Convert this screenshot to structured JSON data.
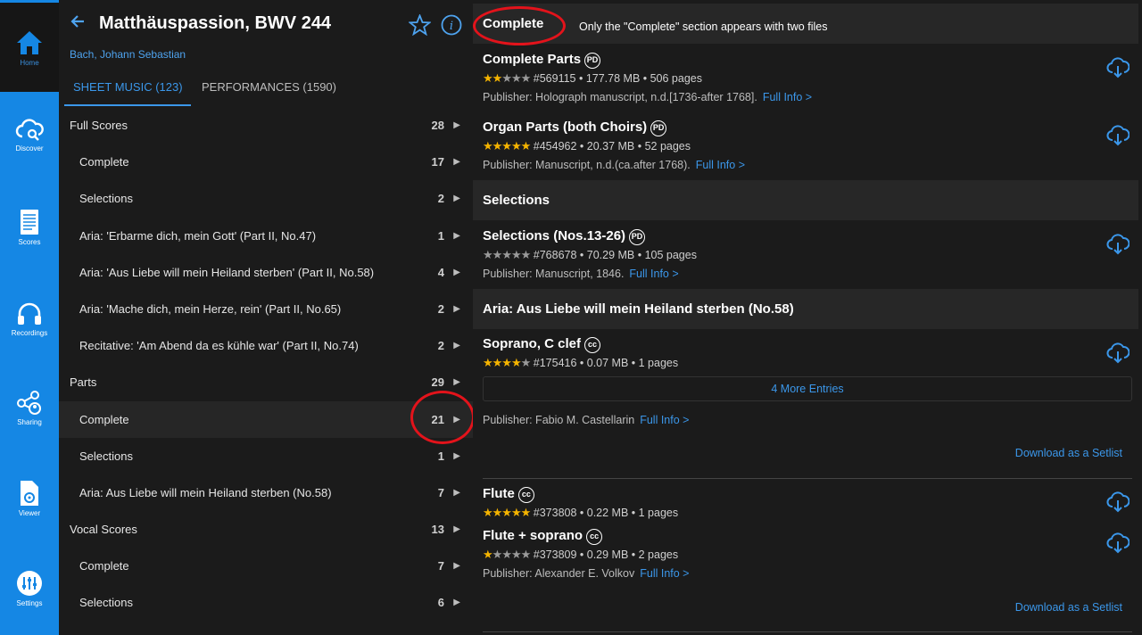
{
  "rail": [
    {
      "label": "Home",
      "icon": "home-icon"
    },
    {
      "label": "Discover",
      "icon": "cloud-search-icon"
    },
    {
      "label": "Scores",
      "icon": "scores-icon"
    },
    {
      "label": "Recordings",
      "icon": "headphones-icon"
    },
    {
      "label": "Sharing",
      "icon": "share-icon"
    },
    {
      "label": "Viewer",
      "icon": "pdf-viewer-icon"
    },
    {
      "label": "Settings",
      "icon": "settings-sliders-icon"
    }
  ],
  "header": {
    "title": "Matthäuspassion, BWV 244",
    "composer": "Bach, Johann Sebastian"
  },
  "tabs": {
    "sheet": "SHEET MUSIC (123)",
    "perf": "PERFORMANCES (1590)"
  },
  "list": [
    {
      "label": "Full Scores",
      "count": "28"
    },
    {
      "label": "Complete",
      "count": "17"
    },
    {
      "label": "Selections",
      "count": "2"
    },
    {
      "label": "Aria: 'Erbarme dich, mein Gott' (Part II, No.47)",
      "count": "1"
    },
    {
      "label": "Aria: 'Aus Liebe will mein Heiland sterben' (Part II, No.58)",
      "count": "4"
    },
    {
      "label": "Aria: 'Mache dich, mein Herze, rein' (Part II, No.65)",
      "count": "2"
    },
    {
      "label": "Recitative: 'Am Abend da es kühle war' (Part II, No.74)",
      "count": "2"
    },
    {
      "label": "Parts",
      "count": "29"
    },
    {
      "label": "Complete",
      "count": "21"
    },
    {
      "label": "Selections",
      "count": "1"
    },
    {
      "label": "Aria: Aus Liebe will mein Heiland sterben (No.58)",
      "count": "7"
    },
    {
      "label": "Vocal Scores",
      "count": "13"
    },
    {
      "label": "Complete",
      "count": "7"
    },
    {
      "label": "Selections",
      "count": "6"
    }
  ],
  "right": {
    "complete_head": "Complete",
    "annotation": "Only the \"Complete\" section appears with two files",
    "selections_head": "Selections",
    "aria_head": "Aria: Aus Liebe will mein Heiland sterben (No.58)",
    "full_info": "Full Info >",
    "more_entries": "4 More Entries",
    "setlist": "Download as a Setlist",
    "files": [
      {
        "name": "Complete Parts",
        "license": "PD",
        "rating": 2,
        "meta": "#569115 • 177.78 MB • 506 pages",
        "publisher": "Publisher: Holograph manuscript, n.d.[1736-after 1768]."
      },
      {
        "name": "Organ Parts (both Choirs)",
        "license": "PD",
        "rating": 5,
        "meta": "#454962 • 20.37 MB • 52 pages",
        "publisher": "Publisher: Manuscript, n.d.(ca.after 1768)."
      },
      {
        "name": "Selections (Nos.13-26)",
        "license": "PD",
        "rating": 0,
        "meta": "#768678 • 70.29 MB • 105 pages",
        "publisher": "Publisher: Manuscript, 1846."
      },
      {
        "name": "Soprano, C clef",
        "license": "CC",
        "rating": 4,
        "meta": "#175416 • 0.07 MB • 1 pages",
        "publisher": "Publisher: Fabio M. Castellarin"
      },
      {
        "name": "Flute",
        "license": "CC",
        "rating": 5,
        "meta": "#373808 • 0.22 MB • 1 pages",
        "publisher": ""
      },
      {
        "name": "Flute + soprano",
        "license": "CC",
        "rating": 1,
        "meta": "#373809 • 0.29 MB • 2 pages",
        "publisher": "Publisher: Alexander E. Volkov"
      }
    ]
  },
  "colors": {
    "accent": "#1587e4",
    "link": "#3b97ea",
    "star": "#f5b400",
    "annotation": "#e3131b"
  }
}
